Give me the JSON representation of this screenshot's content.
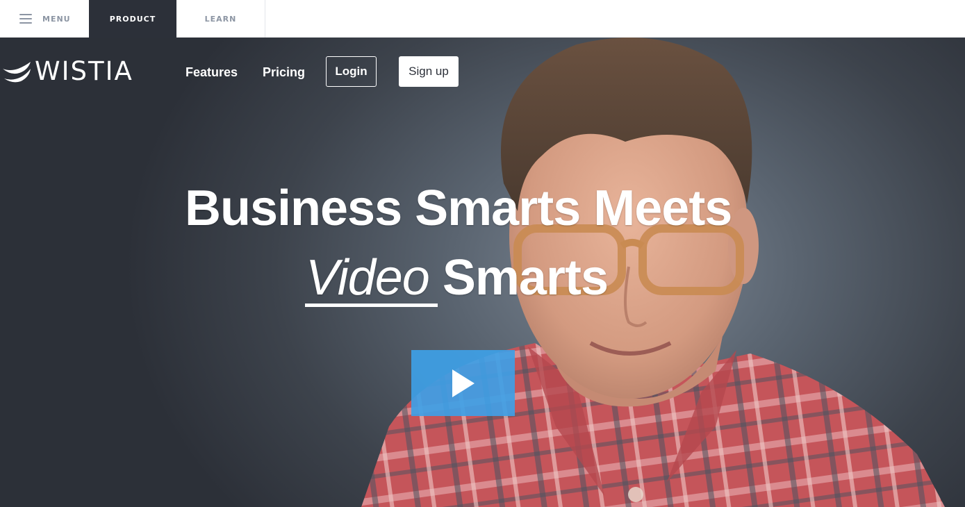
{
  "topbar": {
    "menu_label": "MENU",
    "product_label": "PRODUCT",
    "learn_label": "LEARN"
  },
  "nav": {
    "logo_text": "WISTIA",
    "features_label": "Features",
    "pricing_label": "Pricing",
    "login_label": "Login",
    "signup_label": "Sign up"
  },
  "hero": {
    "headline_line1": "Business Smarts Meets",
    "headline_video_word": "Video",
    "headline_line2_rest": " Smarts",
    "play_icon": "play-icon"
  },
  "colors": {
    "active_tab": "#2c3039",
    "tab_text": "#8c95a3",
    "play_button": "#3ea0e6",
    "hero_text": "#ffffff"
  }
}
